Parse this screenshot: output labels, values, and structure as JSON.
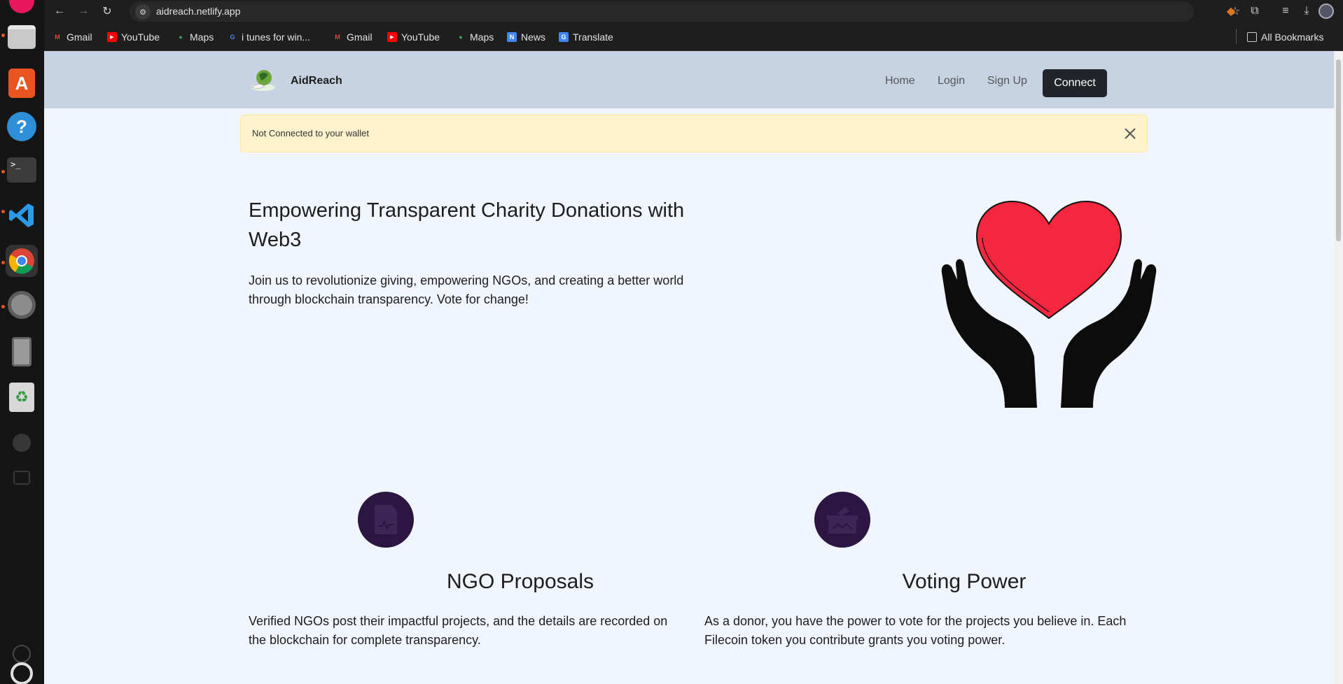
{
  "browser": {
    "url": "aidreach.netlify.app",
    "bookmarks": [
      {
        "label": "Gmail",
        "icon": "gmail-icon",
        "color": "#ea4335"
      },
      {
        "label": "YouTube",
        "icon": "youtube-icon",
        "color": "#ff0000"
      },
      {
        "label": "Maps",
        "icon": "maps-icon",
        "color": "#34a853"
      },
      {
        "label": "i tunes for win...",
        "icon": "google-icon",
        "color": "#4285f4"
      },
      {
        "label": "Gmail",
        "icon": "gmail-icon",
        "color": "#ea4335"
      },
      {
        "label": "YouTube",
        "icon": "youtube-icon",
        "color": "#ff0000"
      },
      {
        "label": "Maps",
        "icon": "maps-icon",
        "color": "#34a853"
      },
      {
        "label": "News",
        "icon": "news-icon",
        "color": "#4285f4"
      },
      {
        "label": "Translate",
        "icon": "translate-icon",
        "color": "#4285f4"
      }
    ],
    "all_bookmarks": "All Bookmarks"
  },
  "navbar": {
    "brand": "AidReach",
    "links": [
      "Home",
      "Login",
      "Sign Up"
    ],
    "connect": "Connect"
  },
  "alert": {
    "text": "Not Connected to your wallet"
  },
  "hero": {
    "title": "Empowering Transparent Charity Donations with Web3",
    "text": "Join us to revolutionize giving, empowering NGOs, and creating a better world through blockchain transparency. Vote for change!"
  },
  "features": [
    {
      "title": "NGO Proposals",
      "text": "Verified NGOs post their impactful projects, and the details are recorded on the blockchain for complete transparency.",
      "icon": "document-icon"
    },
    {
      "title": "Voting Power",
      "text": "As a donor, you have the power to vote for the projects you believe in. Each Filecoin token you contribute grants you voting power.",
      "icon": "ballot-box-icon"
    }
  ],
  "colors": {
    "navbar_bg": "#c7d3e3",
    "page_bg": "#f1f6fe",
    "alert_bg": "#fff3cd",
    "feature_icon_bg": "#2a1640",
    "heart": "#f4273f"
  }
}
